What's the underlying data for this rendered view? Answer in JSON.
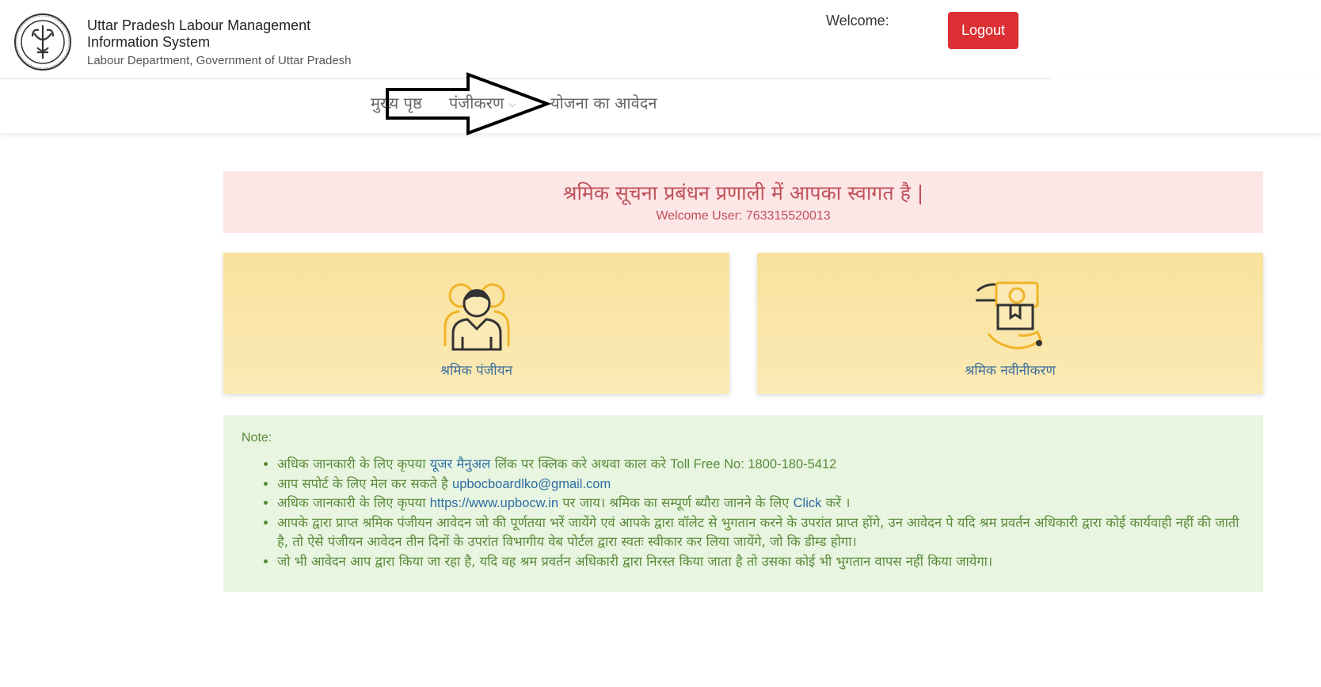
{
  "header": {
    "title": "Uttar Pradesh Labour Management Information System",
    "subtitle": "Labour Department, Government of Uttar Pradesh",
    "welcome_label": "Welcome:",
    "logout_label": "Logout",
    "logo_icon": "up-government-seal-icon"
  },
  "nav": {
    "home": "मुख्य पृष्ठ",
    "registration": "पंजीकरण",
    "scheme_application": "योजना का आवेदन"
  },
  "banner": {
    "heading": "श्रमिक सूचना प्रबंधन प्रणाली में आपका स्वागत है |",
    "user_line": "Welcome User: 763315520013"
  },
  "cards": [
    {
      "label": "श्रमिक पंजीयन",
      "icon": "worker-group-icon"
    },
    {
      "label": "श्रमिक नवीनीकरण",
      "icon": "hand-payment-icon"
    }
  ],
  "note": {
    "title": "Note:",
    "item1_pre": "अधिक जानकारी के लिए कृपया ",
    "item1_link": "यूजर मैनुअल",
    "item1_mid": " लिंक पर क्लिक करे अथवा काल करे ",
    "item1_toll": "Toll Free No: 1800-180-5412",
    "item2_pre": "आप सपोर्ट के लिए मेल कर सकते है ",
    "item2_link": "upbocboardlko@gmail.com",
    "item3_pre": "अधिक जानकारी के लिए कृपया ",
    "item3_link": "https://www.upbocw.in",
    "item3_mid": "  पर जाय। श्रमिक का सम्पूर्ण ब्यौरा जानने के लिए ",
    "item3_click": "Click",
    "item3_post": " करें ।",
    "item4": "आपके द्वारा प्राप्त श्रमिक पंजीयन आवेदन जो की पूर्णतया भरें जायेंगे एवं आपके द्वारा वॉलेट से भुगतान करने के उपरांत प्राप्त होंगे, उन आवेदन पे यदि श्रम प्रवर्तन अधिकारी द्वारा कोई कार्यवाही नहीं की जाती है, तो ऐसे पंजीयन आवेदन तीन दिनों के उपरांत विभागीय वेब पोर्टल द्वारा स्वतः स्वीकार कर लिया जायेंगे, जो कि डीम्ड होगा।",
    "item5": "जो भी आवेदन आप द्वारा किया जा रहा है, यदि वह श्रम प्रवर्तन अधिकारी द्वारा निरस्त किया जाता है तो उसका कोई भी भुगतान वापस नहीं किया जायेगा।"
  },
  "colors": {
    "logout_bg": "#dc3035",
    "banner_bg": "#fde6e6",
    "banner_text": "#c0505a",
    "card_bg": "#f9e29d",
    "note_bg": "#e8f5e0",
    "note_text": "#5a8a3a",
    "link": "#2e6da4"
  }
}
